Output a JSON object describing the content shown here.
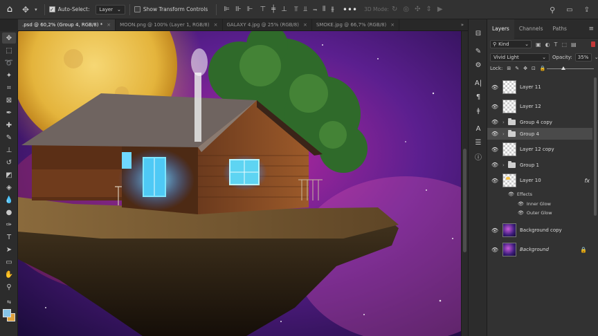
{
  "options_bar": {
    "home_icon": "home-icon",
    "move_tool_icon": "move-tool-icon",
    "auto_select_label": "Auto-Select:",
    "auto_select_checked": true,
    "auto_select_target": "Layer",
    "transform_controls_label": "Show Transform Controls",
    "transform_controls_checked": false,
    "mode_3d_label": "3D Mode:"
  },
  "tabs": [
    {
      "label": ".psd @ 60,2% (Group 4, RGB/8) *",
      "active": true
    },
    {
      "label": "MOON.png @ 100% (Layer 1, RGB/8)",
      "active": false
    },
    {
      "label": "GALAXY 4.jpg @ 25% (RGB/8)",
      "active": false
    },
    {
      "label": "SMOKE.jpg @ 66,7% (RGB/8)",
      "active": false
    }
  ],
  "tab_more": "»",
  "swatches": {
    "foreground": "#86c4e8",
    "background": "#e0a23c"
  },
  "layers_panel": {
    "tabs": [
      "Layers",
      "Channels",
      "Paths"
    ],
    "active_tab": "Layers",
    "filter_kind": "Kind",
    "blend_mode": "Vivid Light",
    "opacity_label": "Opacity:",
    "opacity_value": "35%",
    "opacity_fraction": 0.35,
    "lock_label": "Lock:",
    "layers": [
      {
        "name": "Layer 11",
        "type": "layer",
        "visible": true,
        "selected": false,
        "thumb": "checker"
      },
      {
        "name": "Layer 12",
        "type": "layer",
        "visible": true,
        "selected": false,
        "thumb": "checker"
      },
      {
        "name": "Group 4 copy",
        "type": "group",
        "visible": true,
        "selected": false
      },
      {
        "name": "Group 4",
        "type": "group",
        "visible": true,
        "selected": true
      },
      {
        "name": "Layer 12 copy",
        "type": "layer",
        "visible": true,
        "selected": false,
        "thumb": "checker"
      },
      {
        "name": "Group 1",
        "type": "group",
        "visible": true,
        "selected": false
      },
      {
        "name": "Layer 10",
        "type": "layer",
        "visible": true,
        "selected": false,
        "thumb": "glow",
        "fx": "fx"
      },
      {
        "name": "Background copy",
        "type": "layer",
        "visible": true,
        "selected": false,
        "thumb": "space"
      },
      {
        "name": "Background",
        "type": "layer",
        "visible": true,
        "selected": false,
        "thumb": "space",
        "italic": true,
        "locked": true
      }
    ],
    "effects_label": "Effects",
    "effects": [
      "Inner Glow",
      "Outer Glow"
    ]
  }
}
